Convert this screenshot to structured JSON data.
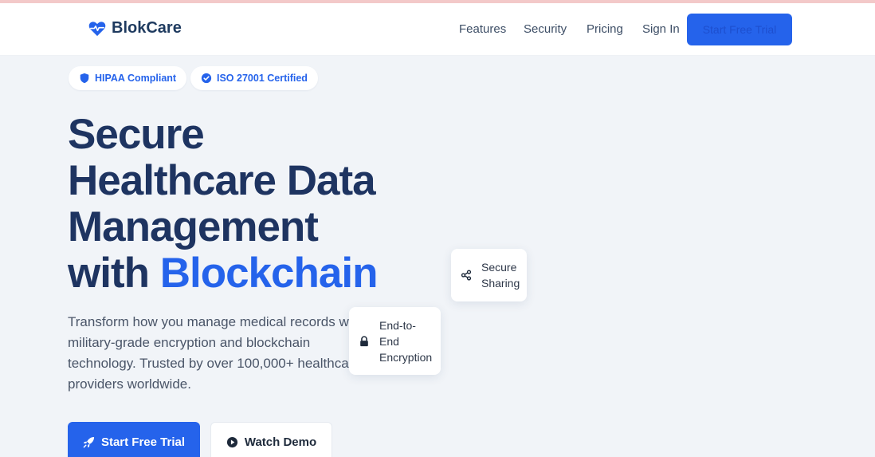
{
  "colors": {
    "accent": "#2563eb",
    "heading": "#1e3461",
    "background": "#f1f4f8"
  },
  "brand": {
    "name": "BlokCare",
    "icon": "heart-pulse-icon"
  },
  "nav": {
    "links": [
      "Features",
      "Security",
      "Pricing",
      "Sign In"
    ],
    "cta_label": "Start Free Trial"
  },
  "badges": [
    {
      "label": "HIPAA Compliant",
      "icon": "shield-icon"
    },
    {
      "label": "ISO 27001 Certified",
      "icon": "check-circle-icon"
    }
  ],
  "hero": {
    "title_line1": "Secure",
    "title_line2": "Healthcare Data",
    "title_line3": "Management",
    "title_line4_plain": "with ",
    "title_line4_accent": "Blockchain",
    "description": "Transform how you manage medical records with military-grade encryption and blockchain technology. Trusted by over 100,000+ healthcare providers worldwide."
  },
  "feature_cards": {
    "sharing": {
      "label": "Secure Sharing",
      "icon": "share-icon"
    },
    "encryption": {
      "label": "End-to-End Encryption",
      "icon": "lock-icon"
    }
  },
  "actions": {
    "primary_label": "Start Free Trial",
    "primary_icon": "rocket-icon",
    "secondary_label": "Watch Demo",
    "secondary_icon": "play-circle-icon"
  }
}
